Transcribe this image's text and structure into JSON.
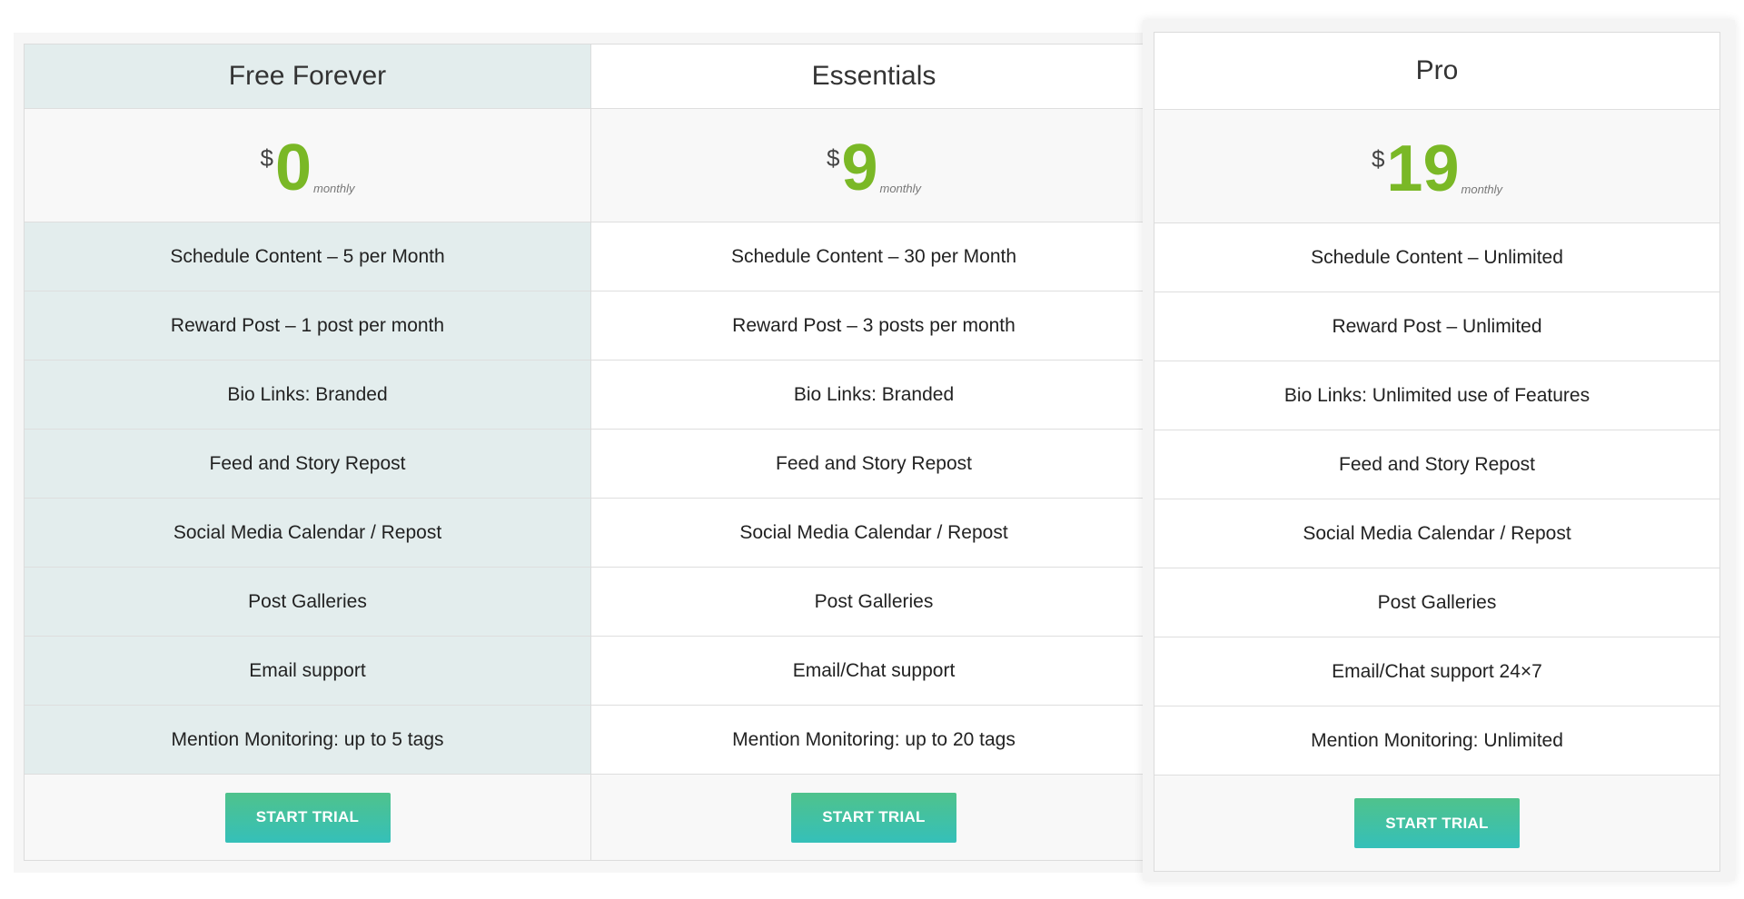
{
  "plans": [
    {
      "name": "Free Forever",
      "currency": "$",
      "amount": "0",
      "period": "monthly",
      "features": [
        "Schedule Content – 5 per Month",
        "Reward Post – 1 post per month",
        "Bio Links: Branded",
        "Feed and Story Repost",
        "Social Media Calendar / Repost",
        "Post Galleries",
        "Email support",
        "Mention Monitoring: up to 5 tags"
      ],
      "button_label": "START TRIAL"
    },
    {
      "name": "Essentials",
      "currency": "$",
      "amount": "9",
      "period": "monthly",
      "features": [
        "Schedule Content – 30 per Month",
        "Reward Post – 3 posts per month",
        "Bio Links: Branded",
        "Feed and Story Repost",
        "Social Media Calendar / Repost",
        "Post Galleries",
        "Email/Chat support",
        "Mention Monitoring: up to 20 tags"
      ],
      "button_label": "START TRIAL"
    },
    {
      "name": "Pro",
      "currency": "$",
      "amount": "19",
      "period": "monthly",
      "features": [
        "Schedule Content – Unlimited",
        "Reward Post – Unlimited",
        "Bio Links: Unlimited use of Features",
        "Feed and Story Repost",
        "Social Media Calendar / Repost",
        "Post Galleries",
        "Email/Chat support 24×7",
        "Mention Monitoring: Unlimited"
      ],
      "button_label": "START TRIAL"
    }
  ],
  "colors": {
    "price_accent": "#7ab826",
    "button_gradient_top": "#4fc28c",
    "button_gradient_bottom": "#35c0b9",
    "free_column_bg": "#e3eded"
  }
}
